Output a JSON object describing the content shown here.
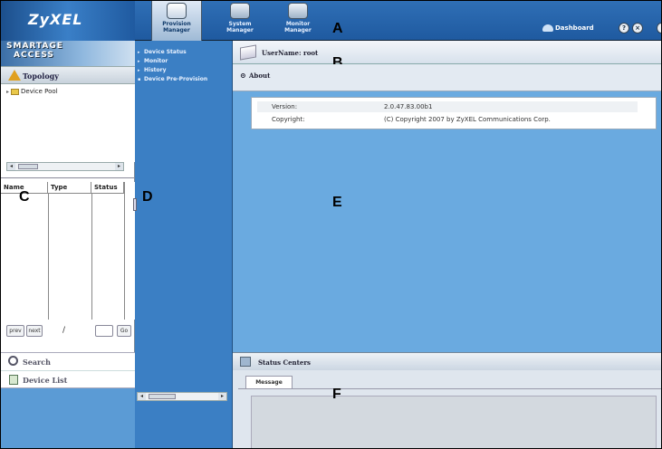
{
  "header": {
    "brand": "ZyXEL",
    "nav": [
      {
        "label_line1": "Provision",
        "label_line2": "Manager",
        "active": true
      },
      {
        "label_line1": "System",
        "label_line2": "Manager",
        "active": false
      },
      {
        "label_line1": "Monitor",
        "label_line2": "Manager",
        "active": false
      }
    ],
    "dashboard": "Dashboard",
    "help_glyph": "?",
    "stop_glyph": "×"
  },
  "callouts": {
    "a": "A",
    "b": "B",
    "c": "C",
    "d": "D",
    "e": "E",
    "f": "F"
  },
  "left_panel": {
    "product_line1": "SMARTAGE",
    "product_line2": "ACCESS",
    "topology_label": "Topology",
    "tree_items": [
      "Device Pool"
    ],
    "table_headers": [
      "Name",
      "Type",
      "Status"
    ],
    "pager": {
      "prev": "prev",
      "next": "next",
      "slash": "/",
      "go": "Go"
    },
    "search_label": "Search",
    "device_list_label": "Device List"
  },
  "middle_menu": {
    "items": [
      {
        "label": "Device Status",
        "selected": false
      },
      {
        "label": "Monitor",
        "selected": false
      },
      {
        "label": "History",
        "selected": false
      },
      {
        "label": "Device Pre-Provision",
        "selected": true
      }
    ]
  },
  "main": {
    "username_label": "UserName: root",
    "about_title": "About",
    "about_rows": [
      {
        "key": "Version:",
        "value": "2.0.47.83.00b1"
      },
      {
        "key": "Copyright:",
        "value": "(C) Copyright 2007 by ZyXEL Communications Corp."
      }
    ]
  },
  "status": {
    "title": "Status Centers",
    "tab_label": "Message"
  },
  "colors": {
    "topbar": "#1f5aa0",
    "workspace": "#6aaae0",
    "middle_panel": "#3b7fc4"
  }
}
